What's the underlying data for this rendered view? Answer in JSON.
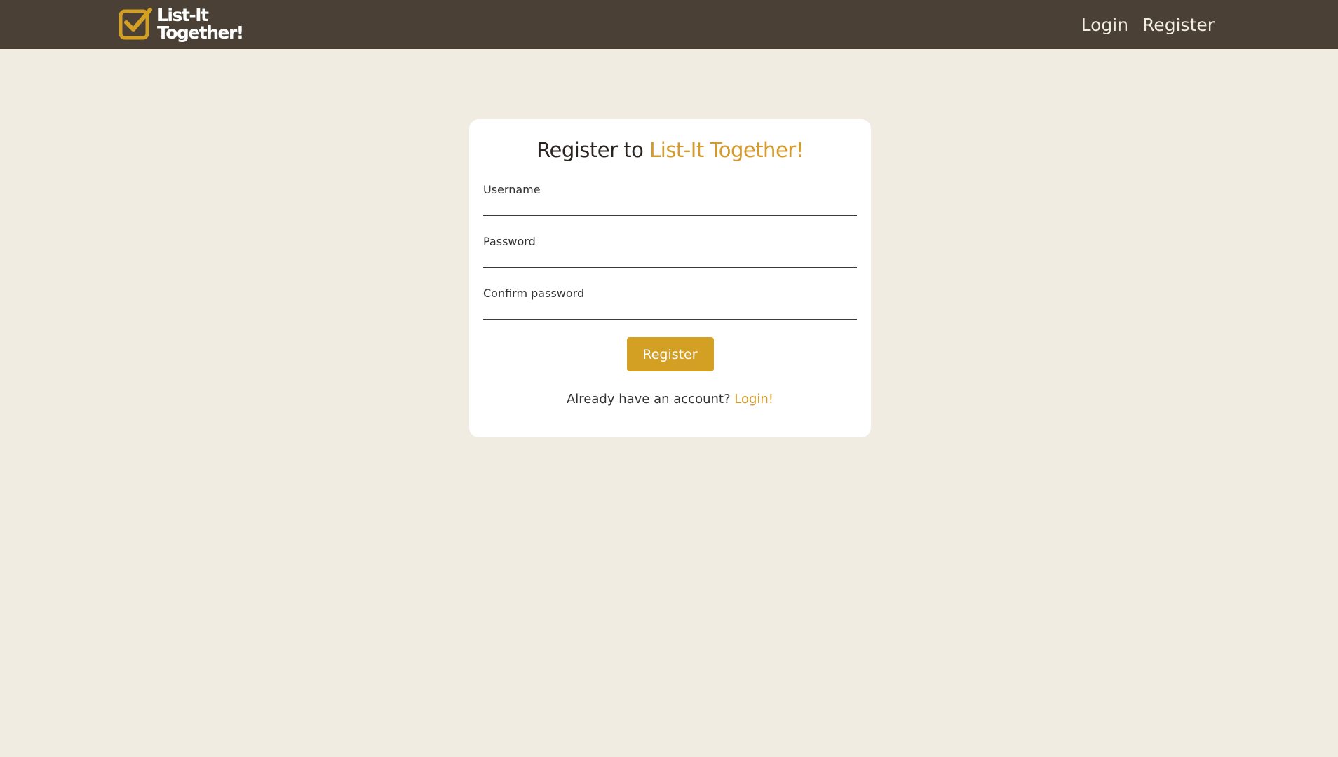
{
  "brand": {
    "logo_line1": "List-It",
    "logo_line2": "Together!",
    "accent_color": "#d4a024",
    "navbar_color": "#4a4035",
    "background_color": "#f1ece2"
  },
  "nav": {
    "login": "Login",
    "register": "Register"
  },
  "form": {
    "title_prefix": "Register to",
    "title_accent": "List-It Together!",
    "username_label": "Username",
    "password_label": "Password",
    "confirm_label": "Confirm password",
    "submit_label": "Register",
    "footer_prompt": "Already have an account?",
    "footer_link": "Login!"
  }
}
